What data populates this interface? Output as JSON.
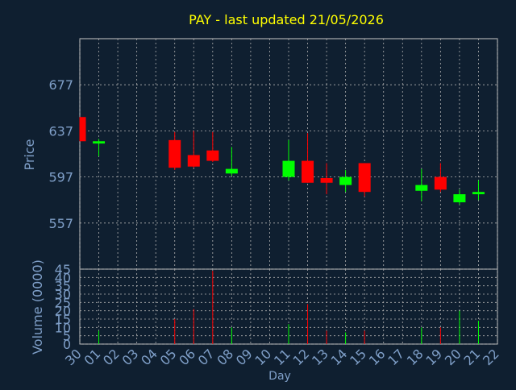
{
  "title": "PAY - last updated 21/05/2026",
  "colors": {
    "background": "#0f1f30",
    "title": "#ffff00",
    "axis_text": "#7f9fc8",
    "label_text": "#000000",
    "frame": "#c8c8c8",
    "grid": "#b0b0b0",
    "up": "#00ff00",
    "down": "#ff0000"
  },
  "chart_data": [
    {
      "type": "candlestick",
      "title": "PAY - last updated 21/05/2026",
      "ylabel": "Price",
      "ylim": [
        517,
        717
      ],
      "yticks": [
        557,
        597,
        637,
        677
      ],
      "categories": [
        "30",
        "01",
        "02",
        "03",
        "04",
        "05",
        "06",
        "07",
        "08",
        "09",
        "10",
        "11",
        "12",
        "13",
        "14",
        "15",
        "16",
        "17",
        "18",
        "19",
        "20",
        "21",
        "22"
      ],
      "candles": [
        {
          "x": "30",
          "open": 649,
          "high": 649,
          "low": 628,
          "close": 628
        },
        {
          "x": "01",
          "open": 626,
          "high": 630,
          "low": 615,
          "close": 628
        },
        {
          "x": "05",
          "open": 629,
          "high": 636,
          "low": 603,
          "close": 605
        },
        {
          "x": "06",
          "open": 616,
          "high": 637,
          "low": 605,
          "close": 606
        },
        {
          "x": "07",
          "open": 620,
          "high": 636,
          "low": 610,
          "close": 611
        },
        {
          "x": "08",
          "open": 600,
          "high": 623,
          "low": 598,
          "close": 604
        },
        {
          "x": "11",
          "open": 597,
          "high": 629,
          "low": 594,
          "close": 611
        },
        {
          "x": "12",
          "open": 611,
          "high": 635,
          "low": 592,
          "close": 592
        },
        {
          "x": "13",
          "open": 596,
          "high": 609,
          "low": 582,
          "close": 592
        },
        {
          "x": "14",
          "open": 590,
          "high": 603,
          "low": 584,
          "close": 597
        },
        {
          "x": "15",
          "open": 609,
          "high": 609,
          "low": 580,
          "close": 584
        },
        {
          "x": "18",
          "open": 585,
          "high": 604,
          "low": 576,
          "close": 590
        },
        {
          "x": "19",
          "open": 597,
          "high": 609,
          "low": 584,
          "close": 586
        },
        {
          "x": "20",
          "open": 575,
          "high": 586,
          "low": 573,
          "close": 582
        },
        {
          "x": "21",
          "open": 582,
          "high": 594,
          "low": 577,
          "close": 584
        }
      ]
    },
    {
      "type": "bar",
      "ylabel": "Volume (0000)",
      "xlabel": "Day",
      "ylim": [
        0,
        45
      ],
      "yticks": [
        0,
        5,
        10,
        15,
        20,
        25,
        30,
        35,
        40,
        45
      ],
      "categories": [
        "30",
        "01",
        "02",
        "03",
        "04",
        "05",
        "06",
        "07",
        "08",
        "09",
        "10",
        "11",
        "12",
        "13",
        "14",
        "15",
        "16",
        "17",
        "18",
        "19",
        "20",
        "21",
        "22"
      ],
      "bars": [
        {
          "x": "01",
          "value": 8,
          "direction": "up"
        },
        {
          "x": "05",
          "value": 15,
          "direction": "down"
        },
        {
          "x": "06",
          "value": 21,
          "direction": "down"
        },
        {
          "x": "07",
          "value": 44,
          "direction": "down"
        },
        {
          "x": "08",
          "value": 10,
          "direction": "up"
        },
        {
          "x": "11",
          "value": 12,
          "direction": "up"
        },
        {
          "x": "12",
          "value": 24,
          "direction": "down"
        },
        {
          "x": "13",
          "value": 8,
          "direction": "down"
        },
        {
          "x": "14",
          "value": 7,
          "direction": "up"
        },
        {
          "x": "15",
          "value": 8,
          "direction": "down"
        },
        {
          "x": "18",
          "value": 10,
          "direction": "up"
        },
        {
          "x": "19",
          "value": 10,
          "direction": "down"
        },
        {
          "x": "20",
          "value": 20,
          "direction": "up"
        },
        {
          "x": "21",
          "value": 14,
          "direction": "up"
        }
      ]
    }
  ]
}
